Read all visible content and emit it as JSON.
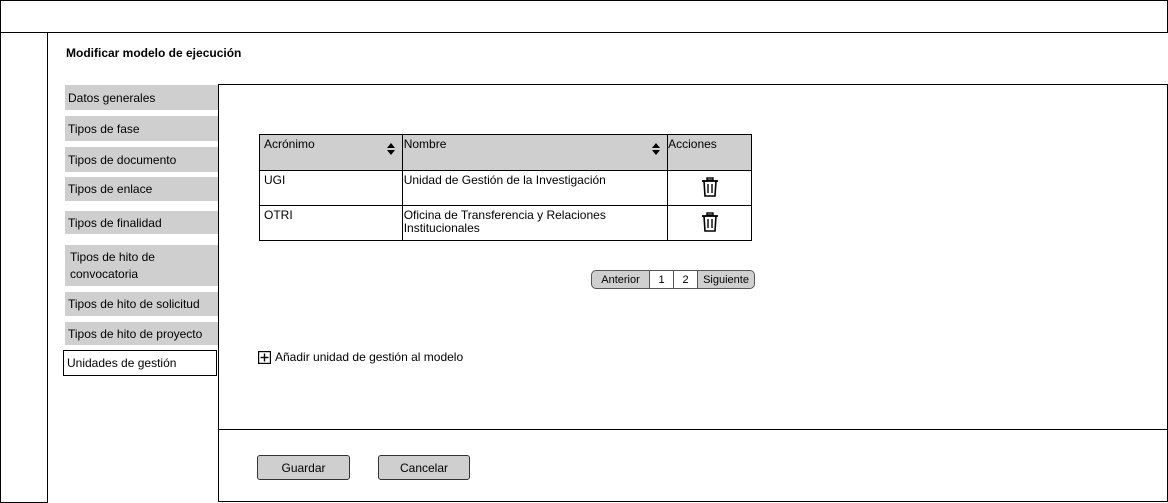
{
  "page": {
    "title": "Modificar modelo de ejecución"
  },
  "sidebar": {
    "items": [
      {
        "label": "Datos generales"
      },
      {
        "label": "Tipos de fase"
      },
      {
        "label": "Tipos de documento"
      },
      {
        "label": "Tipos de enlace"
      },
      {
        "label": "Tipos de finalidad"
      },
      {
        "label": "Tipos de hito de convocatoria"
      },
      {
        "label": "Tipos de hito de solicitud"
      },
      {
        "label": "Tipos de hito de proyecto"
      },
      {
        "label": "Unidades de gestión"
      }
    ],
    "active_index": 8
  },
  "table": {
    "columns": [
      "Acrónimo",
      "Nombre",
      "Acciones"
    ],
    "rows": [
      {
        "acronimo": "UGI",
        "nombre": "Unidad de Gestión de la Investigación",
        "action_icon": "trash-icon"
      },
      {
        "acronimo": "OTRI",
        "nombre": "Oficina de Transferencia y Relaciones Institucionales",
        "action_icon": "trash-icon"
      }
    ]
  },
  "pagination": {
    "prev": "Anterior",
    "pages": [
      "1",
      "2"
    ],
    "next": "Siguiente"
  },
  "add_action": {
    "label": "Añadir unidad de gestión al modelo",
    "icon": "plus-square-icon"
  },
  "footer": {
    "save": "Guardar",
    "cancel": "Cancelar"
  },
  "colors": {
    "nav_bg": "#cfcfcf",
    "header_bg": "#cfcfcf",
    "border": "#000000"
  }
}
